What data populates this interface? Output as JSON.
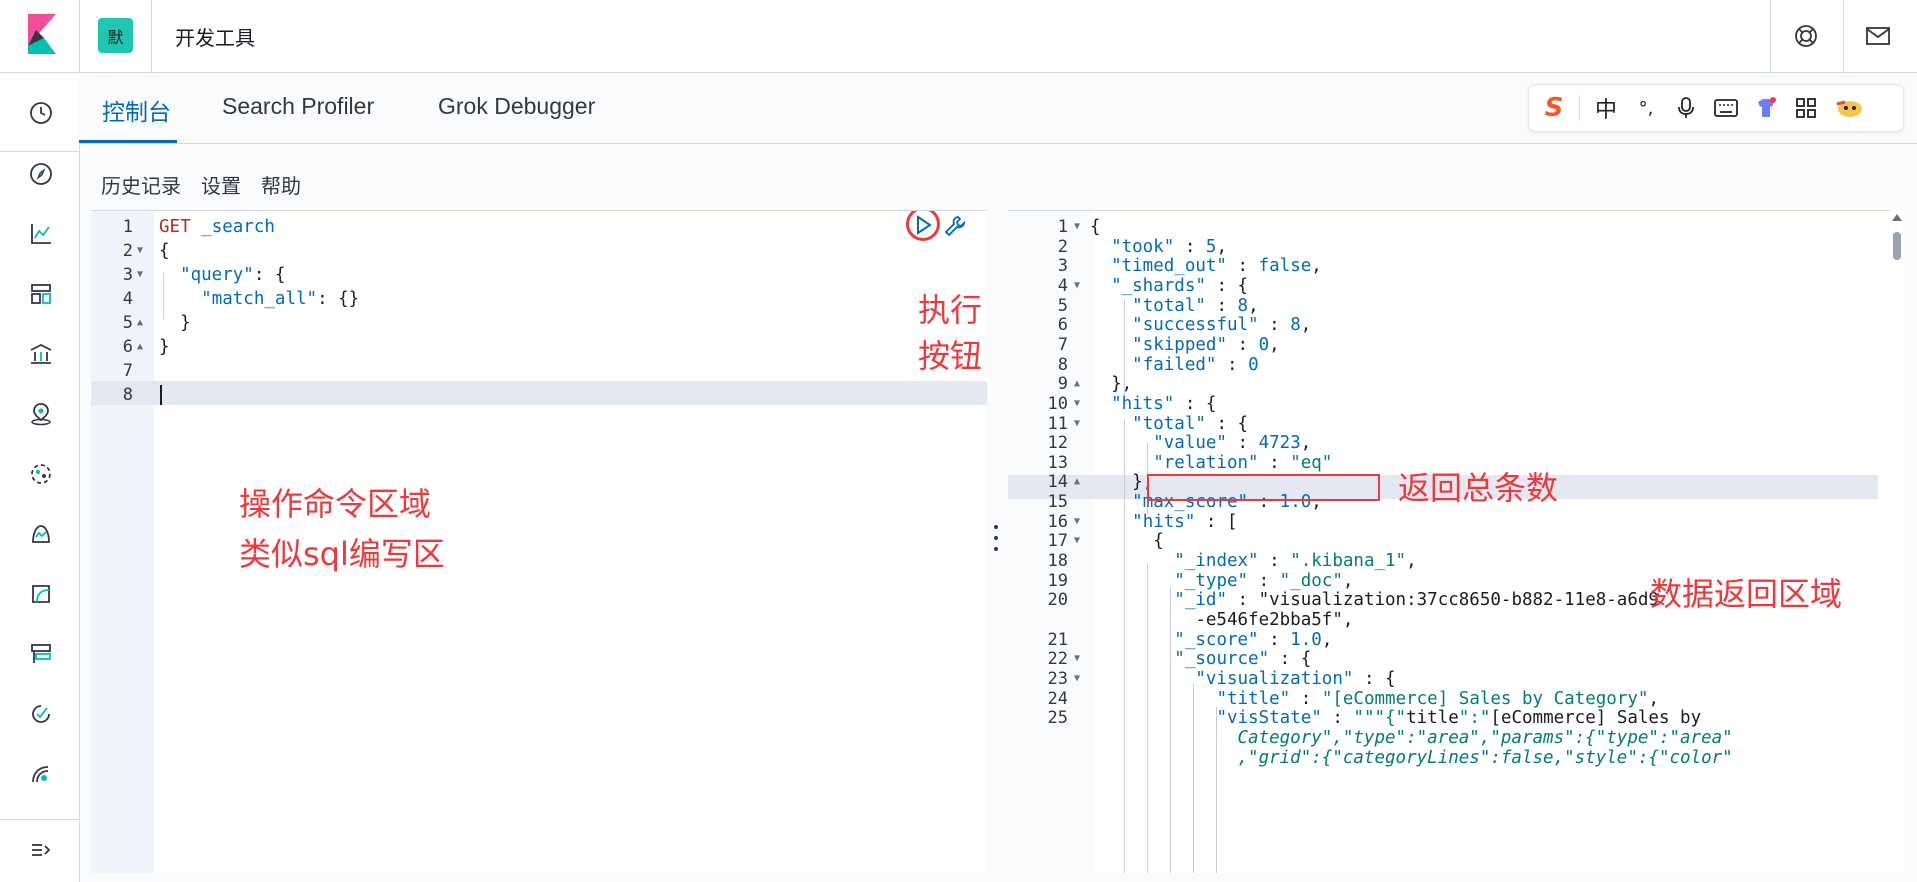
{
  "header": {
    "space_badge": "默",
    "app_title": "开发工具",
    "help_icon": "lifebuoy-icon",
    "mail_icon": "mail-icon"
  },
  "leftnav": {
    "icons": [
      "clock-icon",
      "compass-icon",
      "chart-icon",
      "dashboard-icon",
      "canvas-icon",
      "maps-icon",
      "ml-icon",
      "apm-icon",
      "uptime-icon",
      "siem-icon",
      "monitoring-icon",
      "stack-icon",
      "collapse-icon"
    ]
  },
  "tabs": [
    {
      "label": "控制台",
      "active": true
    },
    {
      "label": "Search Profiler",
      "active": false
    },
    {
      "label": "Grok Debugger",
      "active": false
    }
  ],
  "ime": {
    "logo": "S",
    "mode": "中",
    "punct": "°,",
    "items": [
      "sogou-logo-icon",
      "chinese-mode-icon",
      "punctuation-icon",
      "microphone-icon",
      "keyboard-icon",
      "skin-icon",
      "grid-icon",
      "mascot-icon"
    ]
  },
  "submenu": [
    "历史记录",
    "设置",
    "帮助"
  ],
  "left_editor": {
    "lines": [
      {
        "n": "1",
        "text": "GET _search"
      },
      {
        "n": "2",
        "text": "{"
      },
      {
        "n": "3",
        "text": "  \"query\": {"
      },
      {
        "n": "4",
        "text": "    \"match_all\": {}"
      },
      {
        "n": "5",
        "text": "  }"
      },
      {
        "n": "6",
        "text": "}"
      },
      {
        "n": "7",
        "text": ""
      },
      {
        "n": "8",
        "text": ""
      }
    ]
  },
  "right_editor": {
    "lines": [
      {
        "n": "1",
        "text": "{"
      },
      {
        "n": "2",
        "text": "  \"took\" : 5,"
      },
      {
        "n": "3",
        "text": "  \"timed_out\" : false,"
      },
      {
        "n": "4",
        "text": "  \"_shards\" : {"
      },
      {
        "n": "5",
        "text": "    \"total\" : 8,"
      },
      {
        "n": "6",
        "text": "    \"successful\" : 8,"
      },
      {
        "n": "7",
        "text": "    \"skipped\" : 0,"
      },
      {
        "n": "8",
        "text": "    \"failed\" : 0"
      },
      {
        "n": "9",
        "text": "  },"
      },
      {
        "n": "10",
        "text": "  \"hits\" : {"
      },
      {
        "n": "11",
        "text": "    \"total\" : {"
      },
      {
        "n": "12",
        "text": "      \"value\" : 4723,"
      },
      {
        "n": "13",
        "text": "      \"relation\" : \"eq\""
      },
      {
        "n": "14",
        "text": "    },"
      },
      {
        "n": "15",
        "text": "    \"max_score\" : 1.0,"
      },
      {
        "n": "16",
        "text": "    \"hits\" : ["
      },
      {
        "n": "17",
        "text": "      {"
      },
      {
        "n": "18",
        "text": "        \"_index\" : \".kibana_1\","
      },
      {
        "n": "19",
        "text": "        \"_type\" : \"_doc\","
      },
      {
        "n": "20",
        "text": "        \"_id\" : \"visualization:37cc8650-b882-11e8-a6d9"
      },
      {
        "n": "",
        "text": "          -e546fe2bba5f\","
      },
      {
        "n": "21",
        "text": "        \"_score\" : 1.0,"
      },
      {
        "n": "22",
        "text": "        \"_source\" : {"
      },
      {
        "n": "23",
        "text": "          \"visualization\" : {"
      },
      {
        "n": "24",
        "text": "            \"title\" : \"[eCommerce] Sales by Category\","
      },
      {
        "n": "25",
        "text": "            \"visState\" : \"\"\"{\"title\":\"[eCommerce] Sales by"
      },
      {
        "n": "",
        "text": "              Category\",\"type\":\"area\",\"params\":{\"type\":\"area\""
      },
      {
        "n": "",
        "text": "              ,\"grid\":{\"categoryLines\":false,\"style\":{\"color\""
      }
    ]
  },
  "annotations": {
    "run_button": "执行按钮",
    "command_area_line1": "操作命令区域",
    "command_area_line2": "类似sql编写区",
    "total_count": "返回总条数",
    "response_area": "数据返回区域"
  },
  "colors": {
    "accent": "#006bb8",
    "annotation": "#f0383a",
    "space_badge": "#1ec8b0"
  }
}
